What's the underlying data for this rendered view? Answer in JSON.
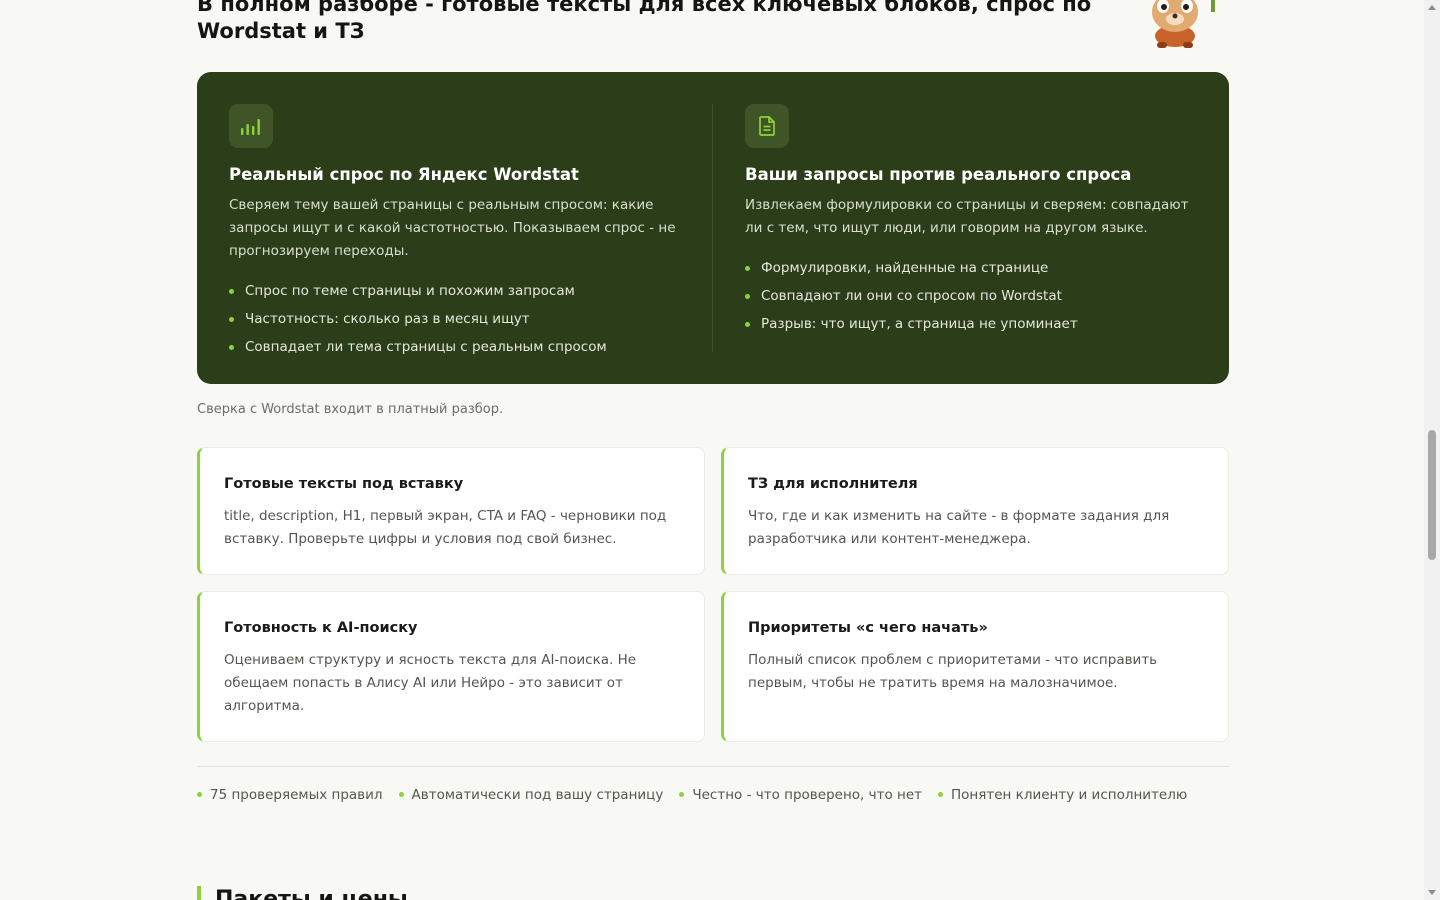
{
  "hero": {
    "title": "В полном разборе - готовые тексты для всех ключевых блоков, спрос по Wordstat и ТЗ"
  },
  "panel": {
    "left": {
      "icon": "bar-chart-icon",
      "title": "Реальный спрос по Яндекс Wordstat",
      "description": "Сверяем тему вашей страницы с реальным спросом: какие запросы ищут и с какой частотностью. Показываем спрос - не прогнозируем переходы.",
      "bullets": [
        "Спрос по теме страницы и похожим запросам",
        "Частотность: сколько раз в месяц ищут",
        "Совпадает ли тема страницы с реальным спросом"
      ]
    },
    "right": {
      "icon": "document-icon",
      "title": "Ваши запросы против реального спроса",
      "description": "Извлекаем формулировки со страницы и сверяем: совпадают ли с тем, что ищут люди, или говорим на другом языке.",
      "bullets": [
        "Формулировки, найденные на странице",
        "Совпадают ли они со спросом по Wordstat",
        "Разрыв: что ищут, а страница не упоминает"
      ]
    }
  },
  "note": "Сверка с Wordstat входит в платный разбор.",
  "cards": [
    {
      "title": "Готовые тексты под вставку",
      "text": "title, description, H1, первый экран, CTA и FAQ - черновики под вставку. Проверьте цифры и условия под свой бизнес."
    },
    {
      "title": "ТЗ для исполнителя",
      "text": "Что, где и как изменить на сайте - в формате задания для разработчика или контент-менеджера."
    },
    {
      "title": "Готовность к AI-поиску",
      "text": "Оцениваем структуру и ясность текста для AI-поиска. Не обещаем попасть в Алису AI или Нейро - это зависит от алгоритма."
    },
    {
      "title": "Приоритеты «с чего начать»",
      "text": "Полный список проблем с приоритетами - что исправить первым, чтобы не тратить время на малозначимое."
    }
  ],
  "features": [
    "75 проверяемых правил",
    "Автоматически под вашу страницу",
    "Честно - что проверено, что нет",
    "Понятен клиенту и исполнителю"
  ],
  "next_section": {
    "title": "Пакеты и цены"
  },
  "colors": {
    "accent": "#8fd13b",
    "panel": "#2b3d19",
    "background": "#f8f8f4"
  }
}
